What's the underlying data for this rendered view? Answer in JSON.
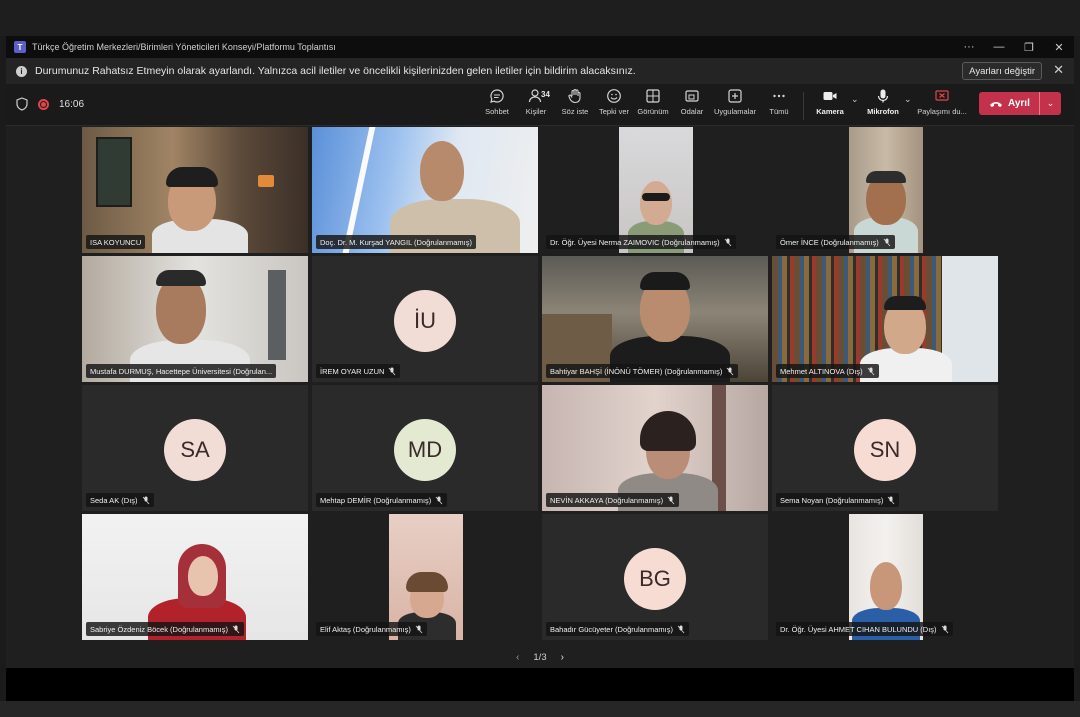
{
  "window": {
    "title": "Türkçe Öğretim Merkezleri/Birimleri Yöneticileri Konseyi/Platformu Toplantısı"
  },
  "infobar": {
    "message": "Durumunuz Rahatsız Etmeyin olarak ayarlandı. Yalnızca acil iletiler ve öncelikli kişilerinizden gelen iletiler için bildirim alacaksınız.",
    "button": "Ayarları değiştir"
  },
  "toolbar": {
    "time": "16:06",
    "people_count": "34",
    "chat": "Sohbet",
    "people": "Kişiler",
    "raise_hand": "Söz iste",
    "react": "Tepki ver",
    "view": "Görünüm",
    "rooms": "Odalar",
    "apps": "Uygulamalar",
    "more": "Tümü",
    "camera": "Kamera",
    "mic": "Mikrofon",
    "share": "Paylaşımı du...",
    "leave": "Ayrıl"
  },
  "participants": [
    {
      "name": "ISA KOYUNCU"
    },
    {
      "name": "Doç. Dr. M. Kurşad YANGIL (Doğrulanmamış)"
    },
    {
      "name": "Dr. Öğr. Üyesi Nerma ZAIMOVIC (Doğrulanmamış)"
    },
    {
      "name": "Ömer İNCE (Doğrulanmamış)"
    },
    {
      "name": "Mustafa DURMUŞ, Hacettepe Üniversitesi (Doğrulan..."
    },
    {
      "name": "İREM OYAR UZUN",
      "initials": "İU"
    },
    {
      "name": "Bahtiyar BAHŞİ (İNÖNÜ TÖMER) (Doğrulanmamış)"
    },
    {
      "name": "Mehmet ALTINOVA (Dış)"
    },
    {
      "name": "Seda AK (Dış)",
      "initials": "SA"
    },
    {
      "name": "Mehtap DEMİR (Doğrulanmamış)",
      "initials": "MD"
    },
    {
      "name": "NEVİN AKKAYA (Doğrulanmamış)"
    },
    {
      "name": "Sema Noyan (Doğrulanmamış)",
      "initials": "SN"
    },
    {
      "name": "Sabriye Özdeniz Böcek (Doğrulanmamış)"
    },
    {
      "name": "Elif Aktaş (Doğrulanmamış)"
    },
    {
      "name": "Bahadır Gücüyeter (Doğrulanmamış)",
      "initials": "BG"
    },
    {
      "name": "Dr. Öğr. Üyesi AHMET CIHAN BULUNDU (Dış)"
    }
  ],
  "pager": {
    "label": "1/3"
  },
  "colors": {
    "accent": "#7f85f5",
    "leave": "#c4314b",
    "avatar_bg": "#f2dcd6"
  }
}
